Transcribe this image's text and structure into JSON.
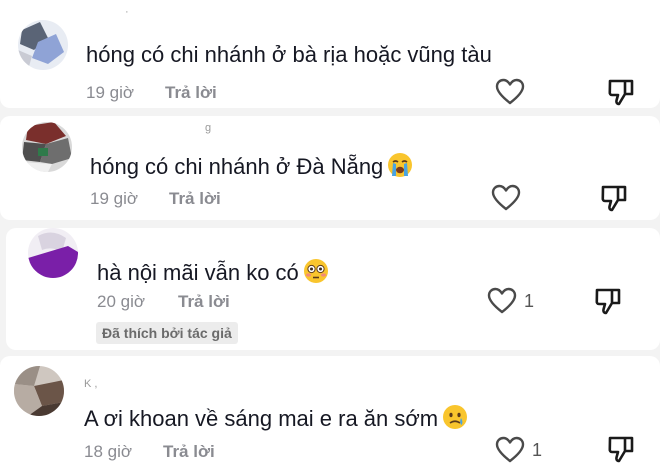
{
  "comments": [
    {
      "text": "hóng có chi nhánh ở bà rịa hoặc vũng tàu",
      "time": "19 giờ",
      "reply_label": "Trả lời",
      "likes": "",
      "emoji": "",
      "username_fragment": "·"
    },
    {
      "text": "hóng có chi nhánh ở Đà Nẵng",
      "time": "19 giờ",
      "reply_label": "Trả lời",
      "likes": "",
      "emoji": "crying-face",
      "username_fragment": "g"
    },
    {
      "text": "hà nội mãi vẫn ko có",
      "time": "20 giờ",
      "reply_label": "Trả lời",
      "likes": "1",
      "emoji": "flushed-face",
      "badge": "Đã thích bởi tác giả"
    },
    {
      "text": "A ơi khoan về sáng mai e ra ăn sớm",
      "time": "18 giờ",
      "reply_label": "Trả lời",
      "likes": "1",
      "emoji": "crying-smile-face",
      "username_fragment": "K    ,"
    }
  ],
  "colors": {
    "text": "#161823",
    "meta": "#8a8b91",
    "background": "#f3f3f3",
    "card": "#ffffff"
  }
}
